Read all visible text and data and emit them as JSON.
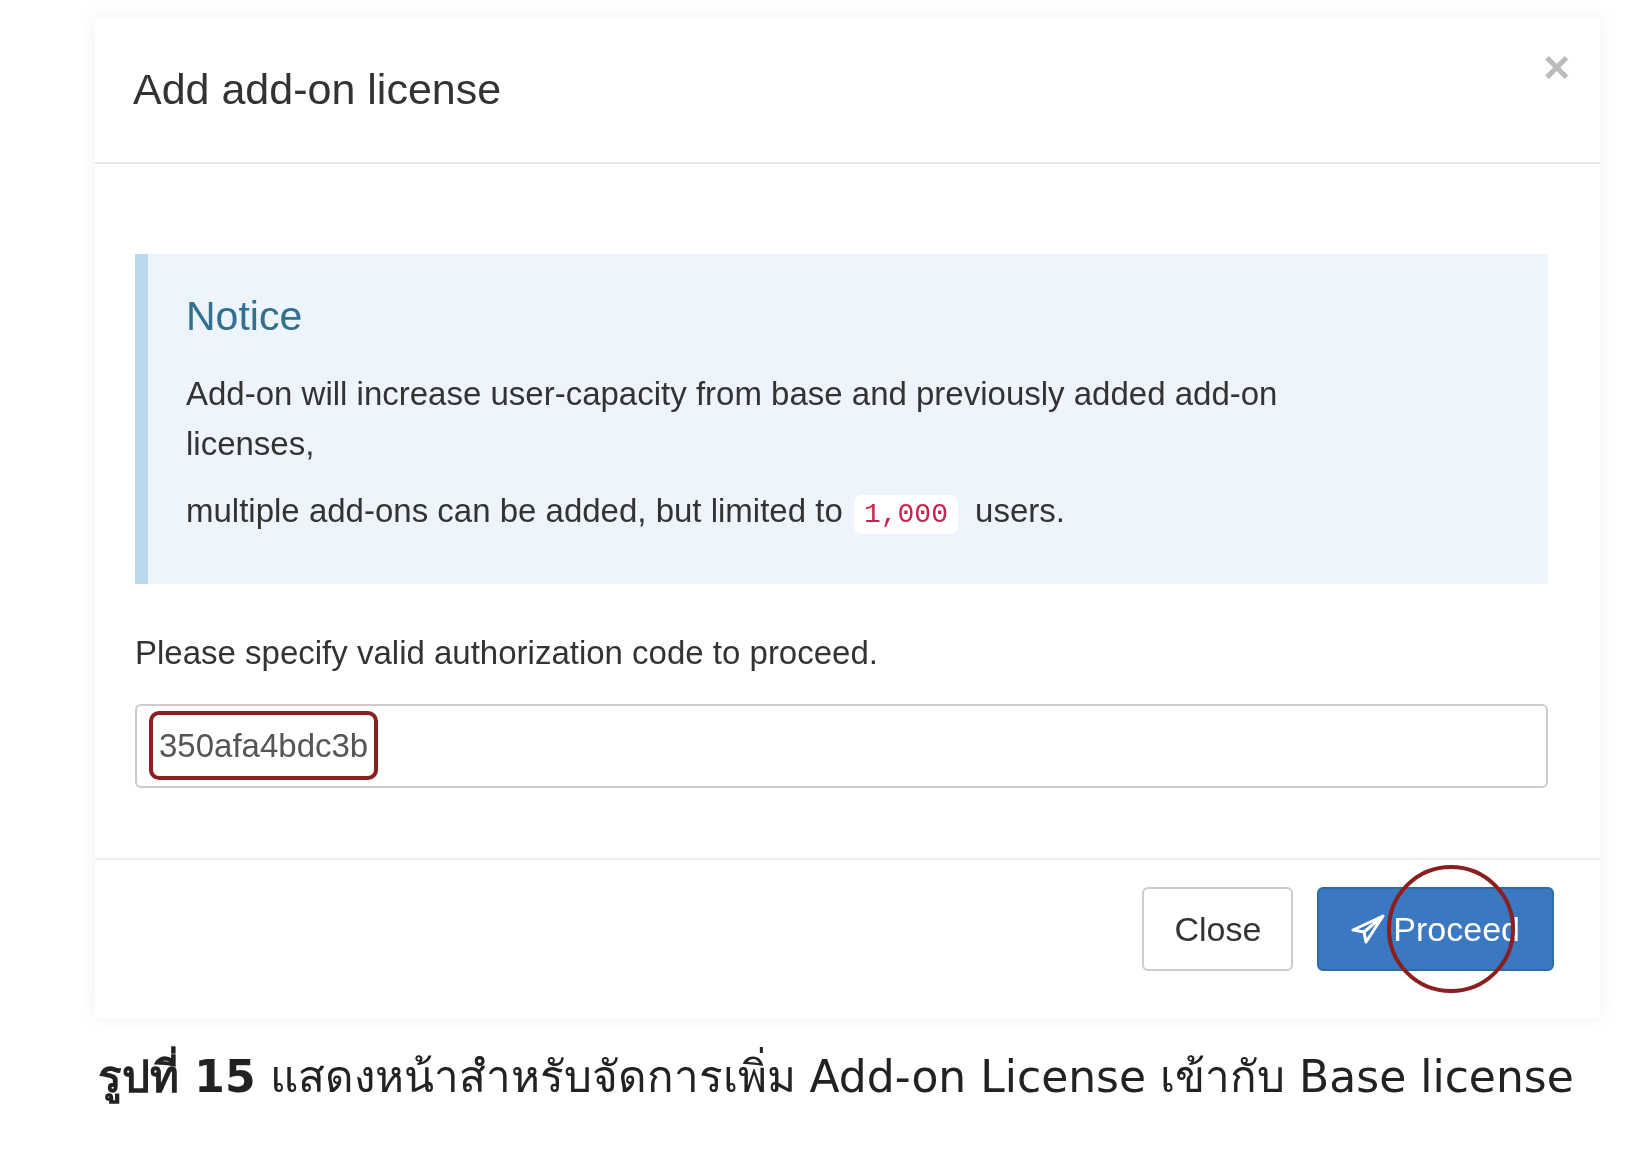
{
  "dialog": {
    "title": "Add add-on license",
    "close_icon": "×",
    "notice": {
      "heading": "Notice",
      "paragraphs": [
        {
          "text_before": "Add-on will increase user-capacity from base and previously added add-on licenses,"
        },
        {
          "text_before": "multiple add-ons can be added, but limited to",
          "code": "1,000",
          "text_after": "users."
        }
      ]
    },
    "prompt": "Please specify valid authorization code to proceed.",
    "code_field": {
      "value": "350afa4bdc3b",
      "highlighted": true
    },
    "buttons": [
      {
        "kind": "default",
        "label": "Close",
        "highlighted": false
      },
      {
        "kind": "primary",
        "label": "Proceed",
        "highlighted": true
      }
    ]
  },
  "caption": "**รูปที่ 15** แสดงหน้าสำหรับจัดการเพิ่ม Add-on License เข้ากับ Base license"
}
